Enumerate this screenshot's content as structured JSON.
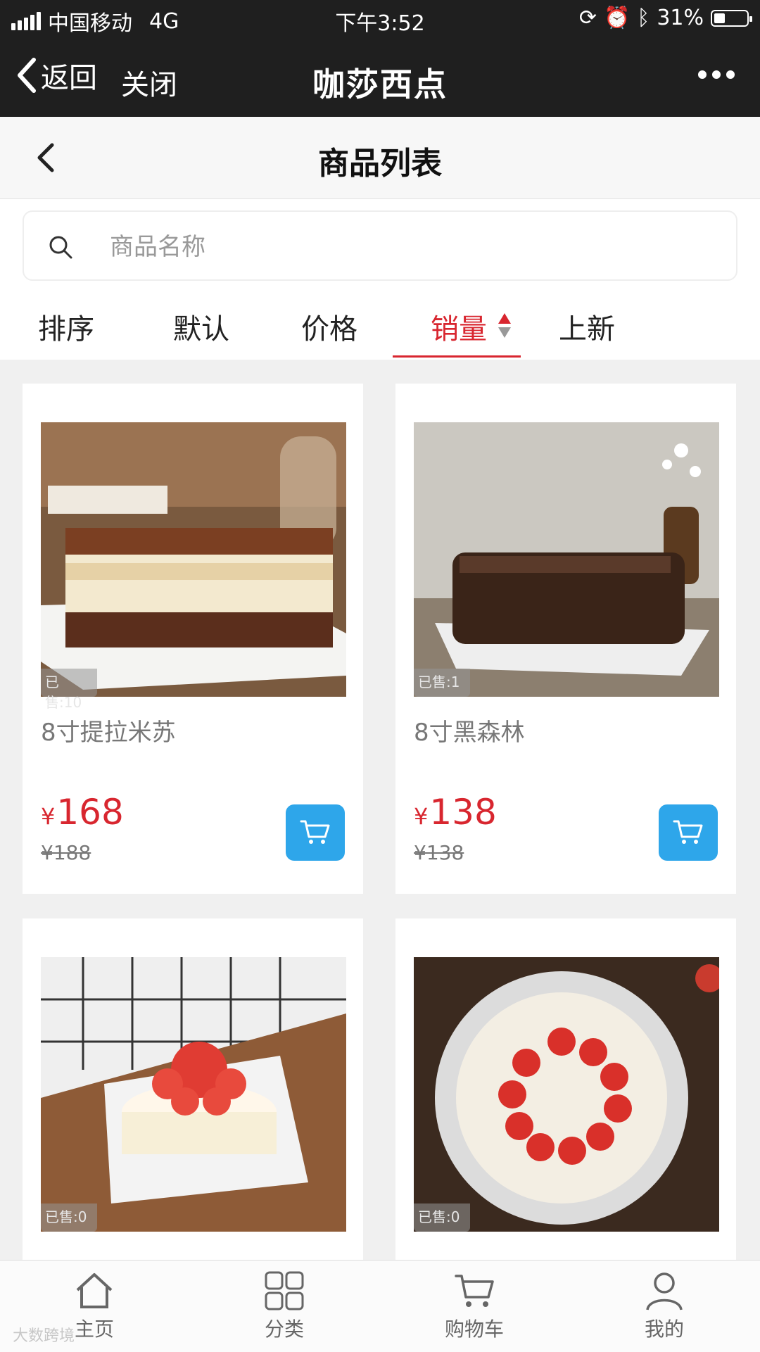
{
  "status_bar": {
    "carrier": "中国移动",
    "network": "4G",
    "time": "下午3:52",
    "battery": "31%"
  },
  "wechat_header": {
    "back_label": "返回",
    "close_label": "关闭",
    "title": "咖莎西点"
  },
  "page": {
    "title": "商品列表"
  },
  "search": {
    "placeholder": "商品名称",
    "value": ""
  },
  "sort": {
    "label": "排序",
    "options": [
      "默认",
      "价格",
      "销量",
      "上新"
    ],
    "active": "销量"
  },
  "products": [
    {
      "sold": "已售:10",
      "name": "8寸提拉米苏",
      "price_symbol": "¥",
      "price": "168",
      "original_price": "¥188"
    },
    {
      "sold": "已售:1",
      "name": "8寸黑森林",
      "price_symbol": "¥",
      "price": "138",
      "original_price": "¥138"
    },
    {
      "sold": "已售:0",
      "name": "",
      "price_symbol": "",
      "price": "",
      "original_price": ""
    },
    {
      "sold": "已售:0",
      "name": "",
      "price_symbol": "",
      "price": "",
      "original_price": ""
    }
  ],
  "tabbar": {
    "items": [
      {
        "label": "主页",
        "icon": "home-icon"
      },
      {
        "label": "分类",
        "icon": "category-grid-icon"
      },
      {
        "label": "购物车",
        "icon": "cart-icon"
      },
      {
        "label": "我的",
        "icon": "user-icon"
      }
    ]
  },
  "watermark": "大数跨境",
  "colors": {
    "accent_red": "#d8262f",
    "cart_blue": "#2ea6ea",
    "header_dark": "#1f1f1f"
  }
}
